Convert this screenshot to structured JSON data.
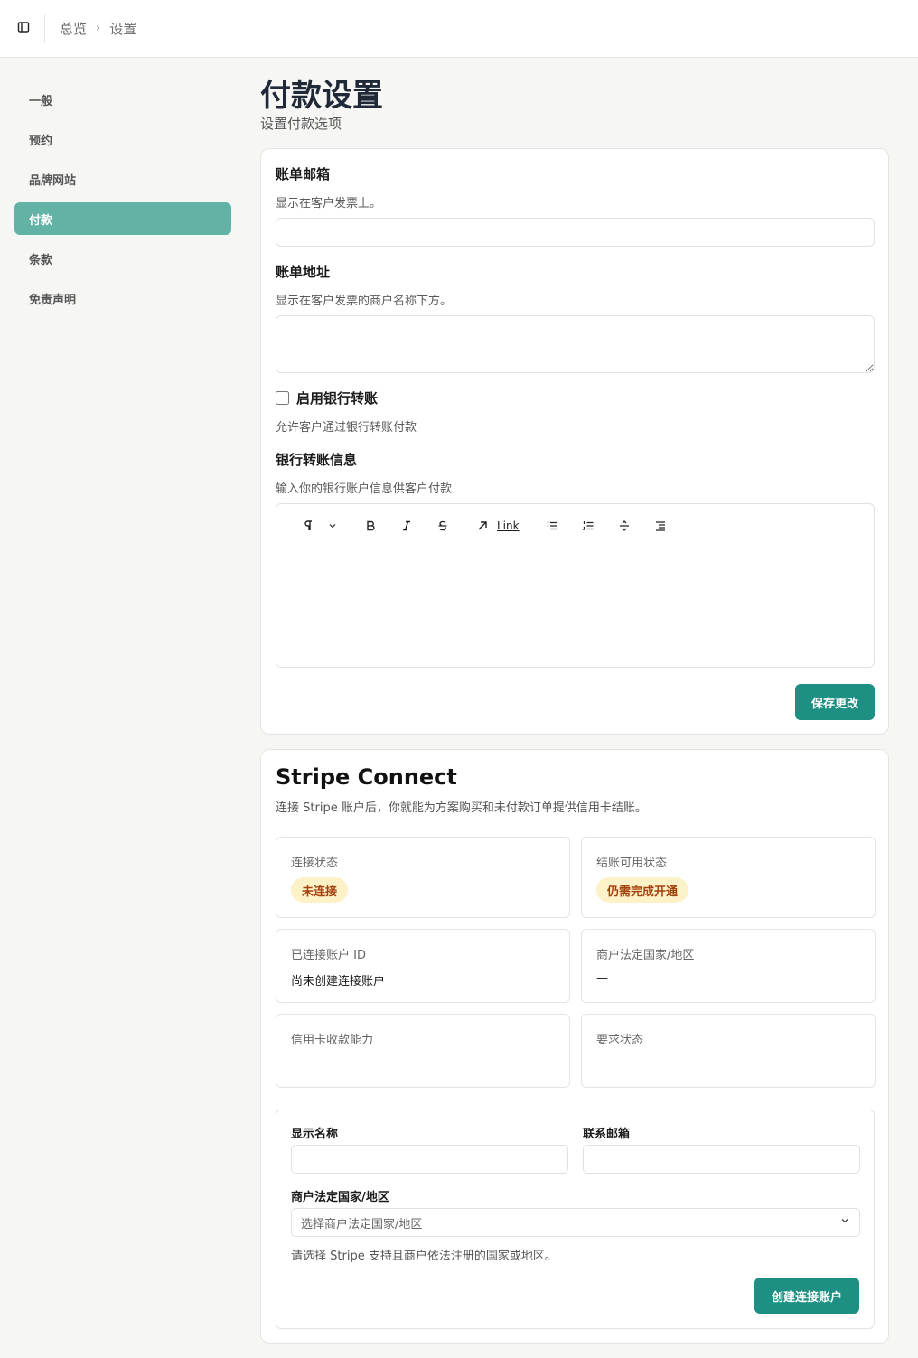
{
  "header": {
    "breadcrumb": [
      "总览",
      "设置"
    ]
  },
  "sidebar": {
    "items": [
      {
        "label": "一般",
        "active": false
      },
      {
        "label": "预约",
        "active": false
      },
      {
        "label": "品牌网站",
        "active": false
      },
      {
        "label": "付款",
        "active": true
      },
      {
        "label": "条款",
        "active": false
      },
      {
        "label": "免责声明",
        "active": false
      }
    ]
  },
  "page": {
    "title": "付款设置",
    "subtitle": "设置付款选项"
  },
  "payment": {
    "billing_email": {
      "title": "账单邮箱",
      "desc": "显示在客户发票上。",
      "value": ""
    },
    "billing_address": {
      "title": "账单地址",
      "desc": "显示在客户发票的商户名称下方。",
      "value": ""
    },
    "bank_transfer": {
      "label": "启用银行转账",
      "desc": "允许客户通过银行转账付款",
      "checked": false
    },
    "bank_info": {
      "title": "银行转账信息",
      "desc": "输入你的银行账户信息供客户付款"
    },
    "editor_toolbar": {
      "link_label": "Link"
    },
    "save_label": "保存更改"
  },
  "stripe": {
    "title": "Stripe Connect",
    "desc": "连接 Stripe 账户后，你就能为方案购买和未付款订单提供信用卡结账。",
    "connection_status": {
      "label": "连接状态",
      "badge": "未连接"
    },
    "checkout_status": {
      "label": "结账可用状态",
      "badge": "仍需完成开通"
    },
    "account_id": {
      "label": "已连接账户 ID",
      "value": "尚未创建连接账户"
    },
    "legal_country": {
      "label": "商户法定国家/地区",
      "value": "—"
    },
    "card_capability": {
      "label": "信用卡收款能力",
      "value": "—"
    },
    "requirements": {
      "label": "要求状态",
      "value": "—"
    },
    "form": {
      "display_name_label": "显示名称",
      "contact_email_label": "联系邮箱",
      "country_label": "商户法定国家/地区",
      "country_placeholder": "选择商户法定国家/地区",
      "country_hint": "请选择 Stripe 支持且商户依法注册的国家或地区。",
      "create_label": "创建连接账户"
    }
  },
  "colors": {
    "accent": "#1e8f83",
    "nav_active": "#63b2a6",
    "badge_bg": "#fdf1c7",
    "badge_text": "#a4420e"
  }
}
